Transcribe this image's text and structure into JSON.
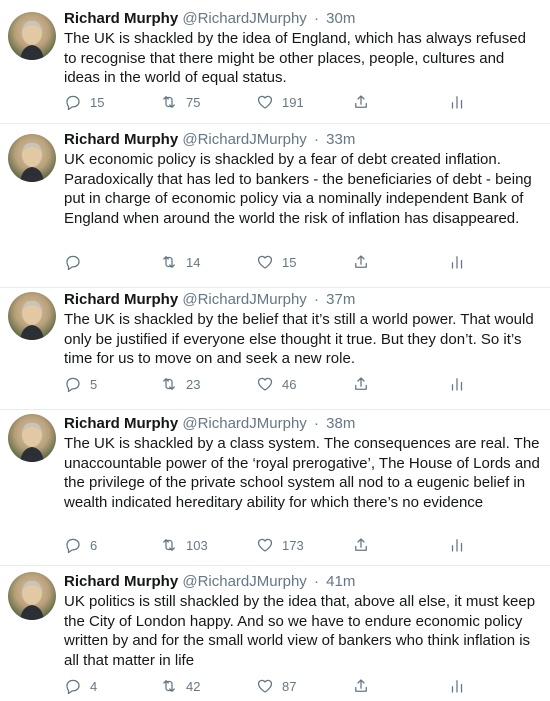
{
  "author": {
    "name": "Richard Murphy",
    "handle": "@RichardJMurphy",
    "separator": "·"
  },
  "icons": {
    "reply": "reply-icon",
    "retweet": "retweet-icon",
    "like": "heart-icon",
    "share": "share-icon",
    "analytics": "analytics-icon"
  },
  "tweets": [
    {
      "time": "30m",
      "text": "The UK is shackled by the idea of England, which has always refused to recognise that there might be other places, people, cultures and ideas in the world of equal status.",
      "replies": "15",
      "retweets": "75",
      "likes": "191"
    },
    {
      "time": "33m",
      "text": "UK economic policy is shackled by a fear of debt created inflation. Paradoxically that has led to bankers - the beneficiaries of debt - being put in charge of economic policy via a nominally independent Bank of England when around the world the risk of inflation has disappeared.",
      "replies": "",
      "retweets": "14",
      "likes": "15"
    },
    {
      "time": "37m",
      "text": "The UK is shackled by the belief that it’s still a world power. That would only be justified if everyone else thought it true. But they don’t. So it’s time for us to move on and seek a new role.",
      "replies": "5",
      "retweets": "23",
      "likes": "46"
    },
    {
      "time": "38m",
      "text": "The UK is shackled by a class system. The consequences are real. The unaccountable power of the ‘royal prerogative’, The House of Lords and the privilege of the private school system all nod to a eugenic belief in wealth indicated hereditary ability for which there’s no evidence",
      "replies": "6",
      "retweets": "103",
      "likes": "173"
    },
    {
      "time": "41m",
      "text": "UK politics is still shackled by the idea that, above all else, it must keep the City of London happy. And so we have to endure economic policy written by and for the small world view of bankers who think inflation is all that matter in life",
      "replies": "4",
      "retweets": "42",
      "likes": "87"
    }
  ]
}
